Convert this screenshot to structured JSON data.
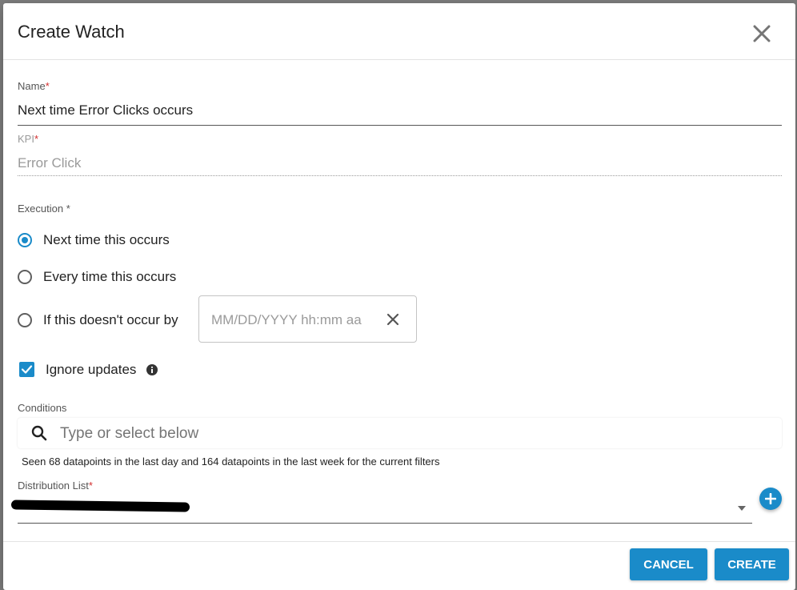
{
  "dialog": {
    "title": "Create Watch",
    "close_icon": "close-icon"
  },
  "name_field": {
    "label": "Name",
    "required_marker": "*",
    "value": "Next time Error Clicks occurs"
  },
  "kpi_field": {
    "label": "KPI",
    "required_marker": "*",
    "value": "Error Click"
  },
  "execution": {
    "label": "Execution *",
    "options": [
      {
        "label": "Next time this occurs",
        "selected": true
      },
      {
        "label": "Every time this occurs",
        "selected": false
      },
      {
        "label": "If this doesn't occur by",
        "selected": false
      }
    ],
    "date_placeholder": "MM/DD/YYYY hh:mm aa",
    "clear_icon": "close-icon"
  },
  "ignore_updates": {
    "label": "Ignore updates",
    "checked": true,
    "info_icon": "info-icon"
  },
  "conditions": {
    "label": "Conditions",
    "search_placeholder": "Type or select below",
    "search_icon": "search-icon",
    "hint": "Seen 68 datapoints in the last day and 164 datapoints in the last week for the current filters"
  },
  "distribution_list": {
    "label": "Distribution List",
    "required_marker": "*",
    "add_icon": "plus-icon",
    "dropdown_icon": "chevron-down-icon"
  },
  "footer": {
    "cancel_label": "CANCEL",
    "create_label": "CREATE"
  },
  "colors": {
    "accent": "#1a8bc9",
    "required": "#d32f2f"
  }
}
